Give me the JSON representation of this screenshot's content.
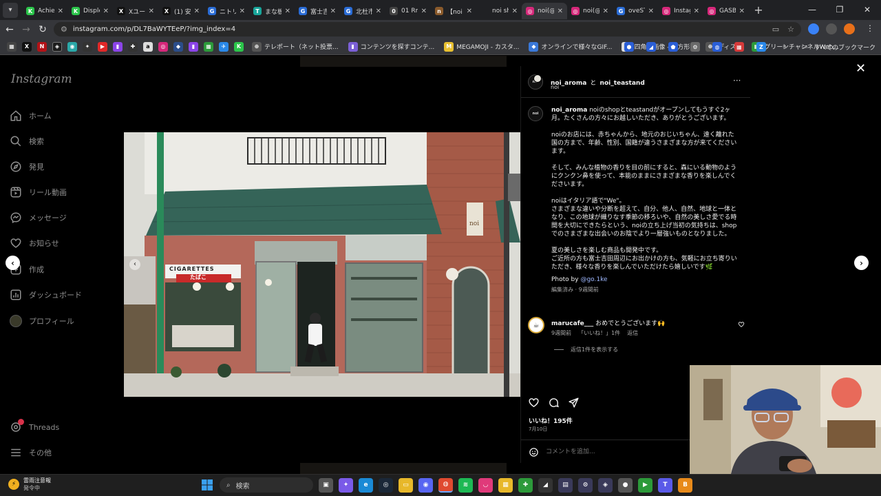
{
  "browser": {
    "tabs": [
      {
        "label": "Achie",
        "color": "#2bc44a",
        "glyph": "K"
      },
      {
        "label": "Disple",
        "color": "#2bc44a",
        "glyph": "K"
      },
      {
        "label": "Xユーザ",
        "color": "#111111",
        "glyph": "X"
      },
      {
        "label": "(1) 安",
        "color": "#111111",
        "glyph": "X"
      },
      {
        "label": "ニトリ(",
        "color": "#2a6cd6",
        "glyph": "G"
      },
      {
        "label": "まな板",
        "color": "#18a59a",
        "glyph": "T"
      },
      {
        "label": "富士吉",
        "color": "#2a6cd6",
        "glyph": "G"
      },
      {
        "label": "北杜市",
        "color": "#2a6cd6",
        "glyph": "G"
      },
      {
        "label": "01 Rm",
        "color": "#444444",
        "glyph": "0"
      },
      {
        "label": "【noi s",
        "color": "#8a5a2b",
        "glyph": "n"
      },
      {
        "label": "noi sh",
        "color": "#202124",
        "glyph": ""
      },
      {
        "label": "noi(@",
        "color": "#d6287a",
        "glyph": "◎"
      },
      {
        "label": "noi(@",
        "color": "#d6287a",
        "glyph": "◎"
      },
      {
        "label": "oveST",
        "color": "#2a6cd6",
        "glyph": "G"
      },
      {
        "label": "Instag",
        "color": "#d6287a",
        "glyph": "◎"
      },
      {
        "label": "GASB",
        "color": "#d6287a",
        "glyph": "◎"
      }
    ],
    "active_tab": 11,
    "url": "instagram.com/p/DL7BaWYTEeP/?img_index=4",
    "bookmarks": [
      {
        "label": "テレポート（ネット投票...",
        "color": "#555555",
        "glyph": "⊕"
      },
      {
        "label": "コンテンツを探すコンテ...",
        "color": "#7b5fd6",
        "glyph": "▮"
      },
      {
        "label": "MEGAMOJI - カスタ...",
        "color": "#e8c030",
        "glyph": "M"
      },
      {
        "label": "オンラインで様々なGIF...",
        "color": "#3a78d8",
        "glyph": "◆"
      },
      {
        "label": "四角い画像 - 長方形...",
        "color": "#dddddd",
        "glyph": "□"
      },
      {
        "label": "ディスコ",
        "color": "#555555",
        "glyph": "⊕"
      },
      {
        "label": "グリーンチャンネルWeb...",
        "color": "#2c9a3a",
        "glyph": "▦"
      }
    ],
    "all_bookmarks": "すべてのブックマーク"
  },
  "sidebar": {
    "logo": "Instagram",
    "items": [
      {
        "label": "ホーム",
        "icon": "home-icon"
      },
      {
        "label": "検索",
        "icon": "search-icon"
      },
      {
        "label": "発見",
        "icon": "compass-icon"
      },
      {
        "label": "リール動画",
        "icon": "reels-icon"
      },
      {
        "label": "メッセージ",
        "icon": "messenger-icon"
      },
      {
        "label": "お知らせ",
        "icon": "heart-icon"
      },
      {
        "label": "作成",
        "icon": "plus-square-icon"
      },
      {
        "label": "ダッシュボード",
        "icon": "dashboard-icon"
      },
      {
        "label": "プロフィール",
        "icon": "profile-avatar"
      }
    ],
    "bottom": [
      {
        "label": "Threads",
        "icon": "threads-icon"
      },
      {
        "label": "その他",
        "icon": "menu-icon"
      }
    ]
  },
  "photo": {
    "sign_cigarettes": "CIGARETTES",
    "sign_shop": "たばこ",
    "sign_noi": "noi"
  },
  "post": {
    "author": "noi_aroma",
    "conjunction": "と",
    "coauthor": "noi_teastand",
    "location": "noi",
    "avatar_text": "noi",
    "caption_author": "noi_aroma",
    "caption_paragraphs": [
      "noiのshopとteastandがオープンしてもうすぐ2ヶ月。たくさんの方々にお越しいただき、ありがとうございます。",
      "noiのお店には、赤ちゃんから、地元のおじいちゃん、遠く離れた国の方まで、年齢、性別、国籍が違うさまざまな方が来てくださいます。",
      "そして、みんな植物の香りを目の前にすると、森にいる動物のようにクンクン鼻を使って、本能のままにさまざまな香りを楽しんでくださいます。",
      "noiはイタリア語で\"We\"。\nさまざまな違いや分断を超えて、自分、他人、自然、地球と一体となり、この地球が織りなす季節の移ろいや、自然の美しさ愛でる時間を大切にできたらという、noiの立ち上げ当初の気持ちは、shopでのさまざまな出会いのお陰でより一層強いものとなりました。",
      "夏の美しさを楽しむ商品も開発中です。\nご近所の方も富士吉田周辺にお出かけの方も、気軽にお立ち寄りいただき、様々な香りを楽しんでいただけたら嬉しいです🌿"
    ],
    "photo_by_label": "Photo by",
    "photo_by_handle": "@go.1ke",
    "edited_meta": "編集済み · 9週間前",
    "comment": {
      "user": "marucafe___",
      "text": "おめでとうございます🙌",
      "time": "9週間前",
      "likes": "「いいね！」1件",
      "reply": "返信"
    },
    "view_replies": "返信1件を表示する",
    "likes_count": "いいね！195件",
    "date": "7月10日",
    "comment_placeholder": "コメントを追加..."
  },
  "taskbar": {
    "weather_title": "雷雨注意報",
    "weather_sub": "発令中",
    "search": "検索"
  }
}
